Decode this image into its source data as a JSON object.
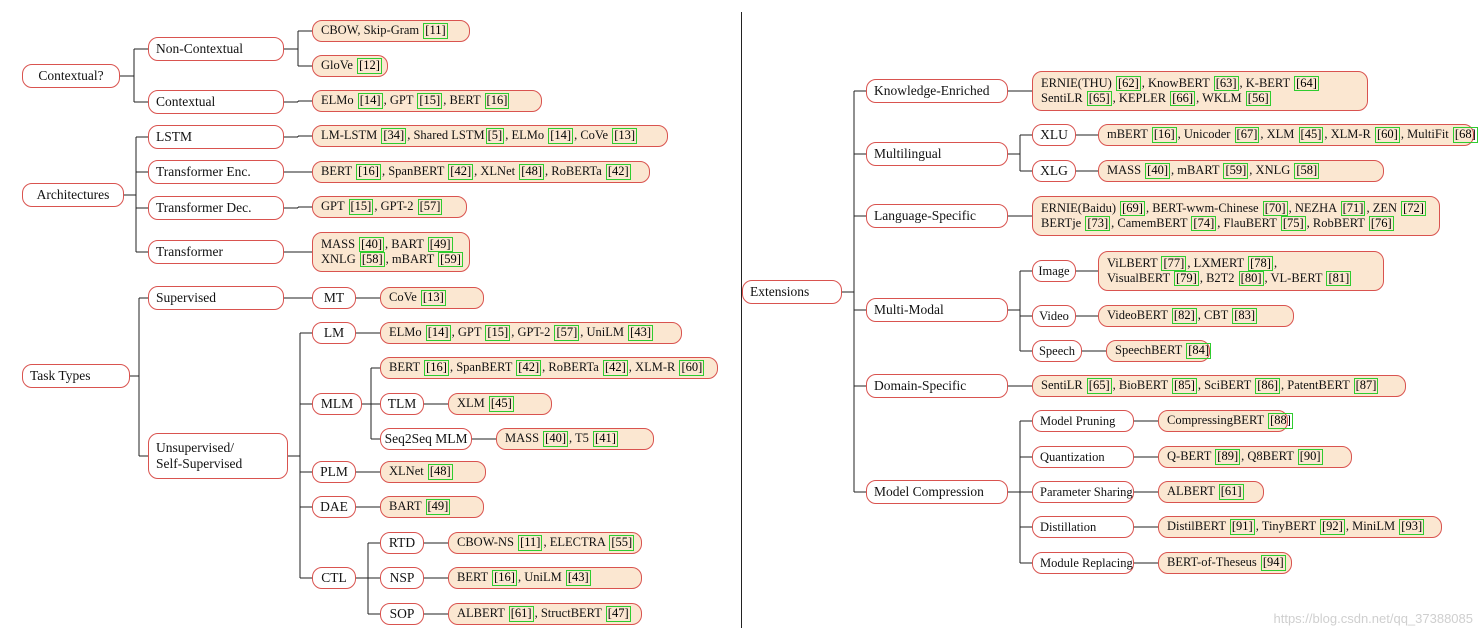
{
  "watermark": "https://blog.csdn.net/qq_37388085",
  "colors": {
    "border": "#d9534f",
    "leaf_fill": "#fbe7d1",
    "ref_box": "#2fcc2f",
    "line": "#222222"
  },
  "left_tree": {
    "contextual": {
      "label": "Contextual?",
      "non_contextual": {
        "label": "Non-Contextual",
        "leaf1": [
          [
            "CBOW, Skip-Gram ",
            "[11]"
          ]
        ],
        "leaf2": [
          [
            "GloVe ",
            "[12]"
          ]
        ]
      },
      "contextual_branch": {
        "label": "Contextual",
        "leaf": [
          [
            "ELMo ",
            "[14]",
            ", GPT ",
            "[15]",
            ", BERT ",
            "[16]"
          ]
        ]
      }
    },
    "architectures": {
      "label": "Architectures",
      "lstm": {
        "label": "LSTM",
        "leaf": [
          [
            "LM-LSTM ",
            "[34]",
            ", Shared LSTM",
            "[5]",
            ", ELMo ",
            "[14]",
            ", CoVe ",
            "[13]"
          ]
        ]
      },
      "enc": {
        "label": "Transformer Enc.",
        "leaf": [
          [
            "BERT ",
            "[16]",
            ", SpanBERT ",
            "[42]",
            ", XLNet ",
            "[48]",
            ", RoBERTa ",
            "[42]"
          ]
        ]
      },
      "dec": {
        "label": "Transformer Dec.",
        "leaf": [
          [
            "GPT ",
            "[15]",
            ", GPT-2 ",
            "[57]"
          ]
        ]
      },
      "transformer": {
        "label": "Transformer",
        "leaf": [
          [
            "MASS ",
            "[40]",
            ", BART ",
            "[49]"
          ],
          [
            "XNLG ",
            "[58]",
            ", mBART ",
            "[59]"
          ]
        ]
      }
    },
    "task_types": {
      "label": "Task Types",
      "supervised": {
        "label": "Supervised",
        "mt": {
          "label": "MT",
          "leaf": [
            [
              "CoVe ",
              "[13]"
            ]
          ]
        }
      },
      "unsupervised": {
        "label_line1": "Unsupervised/",
        "label_line2": "Self-Supervised",
        "lm": {
          "label": "LM",
          "leaf": [
            [
              "ELMo ",
              "[14]",
              ", GPT ",
              "[15]",
              ", GPT-2 ",
              "[57]",
              ", UniLM ",
              "[43]"
            ]
          ]
        },
        "mlm": {
          "label": "MLM",
          "leaf": [
            [
              "BERT ",
              "[16]",
              ", SpanBERT ",
              "[42]",
              ", RoBERTa ",
              "[42]",
              ", XLM-R ",
              "[60]"
            ]
          ],
          "tlm": {
            "label": "TLM",
            "leaf": [
              [
                "XLM ",
                "[45]"
              ]
            ]
          },
          "seq2seq": {
            "label": "Seq2Seq MLM",
            "leaf": [
              [
                "MASS ",
                "[40]",
                ", T5 ",
                "[41]"
              ]
            ]
          }
        },
        "plm": {
          "label": "PLM",
          "leaf": [
            [
              "XLNet ",
              "[48]"
            ]
          ]
        },
        "dae": {
          "label": "DAE",
          "leaf": [
            [
              "BART ",
              "[49]"
            ]
          ]
        },
        "ctl": {
          "label": "CTL",
          "rtd": {
            "label": "RTD",
            "leaf": [
              [
                "CBOW-NS ",
                "[11]",
                ", ELECTRA ",
                "[55]"
              ]
            ]
          },
          "nsp": {
            "label": "NSP",
            "leaf": [
              [
                "BERT ",
                "[16]",
                ", UniLM ",
                "[43]"
              ]
            ]
          },
          "sop": {
            "label": "SOP",
            "leaf": [
              [
                "ALBERT ",
                "[61]",
                ", StructBERT ",
                "[47]"
              ]
            ]
          }
        }
      }
    }
  },
  "right_tree": {
    "extensions": {
      "label": "Extensions",
      "knowledge": {
        "label": "Knowledge-Enriched",
        "leaf": [
          [
            "ERNIE(THU) ",
            "[62]",
            ", KnowBERT ",
            "[63]",
            ", K-BERT ",
            "[64]"
          ],
          [
            "SentiLR ",
            "[65]",
            ", KEPLER ",
            "[66]",
            ", WKLM ",
            "[56]"
          ]
        ]
      },
      "multilingual": {
        "label": "Multilingual",
        "xlu": {
          "label": "XLU",
          "leaf": [
            [
              "mBERT ",
              "[16]",
              ", Unicoder ",
              "[67]",
              ", XLM ",
              "[45]",
              ", XLM-R ",
              "[60]",
              ", MultiFit ",
              "[68]"
            ]
          ]
        },
        "xlg": {
          "label": "XLG",
          "leaf": [
            [
              "MASS ",
              "[40]",
              ", mBART ",
              "[59]",
              ", XNLG ",
              "[58]"
            ]
          ]
        }
      },
      "language": {
        "label": "Language-Specific",
        "leaf": [
          [
            "ERNIE(Baidu) ",
            "[69]",
            ", BERT-wwm-Chinese ",
            "[70]",
            ", NEZHA ",
            "[71]",
            ", ZEN ",
            "[72]"
          ],
          [
            "BERTje ",
            "[73]",
            ", CamemBERT ",
            "[74]",
            ", FlauBERT ",
            "[75]",
            ", RobBERT ",
            "[76]"
          ]
        ]
      },
      "multimodal": {
        "label": "Multi-Modal",
        "image": {
          "label": "Image",
          "leaf": [
            [
              "ViLBERT ",
              "[77]",
              ", LXMERT ",
              "[78]",
              ","
            ],
            [
              "VisualBERT ",
              "[79]",
              ", B2T2 ",
              "[80]",
              ", VL-BERT ",
              "[81]"
            ]
          ]
        },
        "video": {
          "label": "Video",
          "leaf": [
            [
              "VideoBERT ",
              "[82]",
              ", CBT ",
              "[83]"
            ]
          ]
        },
        "speech": {
          "label": "Speech",
          "leaf": [
            [
              "SpeechBERT ",
              "[84]"
            ]
          ]
        }
      },
      "domain": {
        "label": "Domain-Specific",
        "leaf": [
          [
            "SentiLR ",
            "[65]",
            ", BioBERT ",
            "[85]",
            ", SciBERT ",
            "[86]",
            ", PatentBERT ",
            "[87]"
          ]
        ]
      },
      "compression": {
        "label": "Model Compression",
        "pruning": {
          "label": "Model Pruning",
          "leaf": [
            [
              "CompressingBERT ",
              "[88]"
            ]
          ]
        },
        "quant": {
          "label": "Quantization",
          "leaf": [
            [
              "Q-BERT ",
              "[89]",
              ", Q8BERT ",
              "[90]"
            ]
          ]
        },
        "sharing": {
          "label": "Parameter Sharing",
          "leaf": [
            [
              "ALBERT ",
              "[61]"
            ]
          ]
        },
        "distill": {
          "label": "Distillation",
          "leaf": [
            [
              "DistilBERT ",
              "[91]",
              ", TinyBERT ",
              "[92]",
              ", MiniLM ",
              "[93]"
            ]
          ]
        },
        "replace": {
          "label": "Module Replacing",
          "leaf": [
            [
              "BERT-of-Theseus ",
              "[94]"
            ]
          ]
        }
      }
    }
  }
}
